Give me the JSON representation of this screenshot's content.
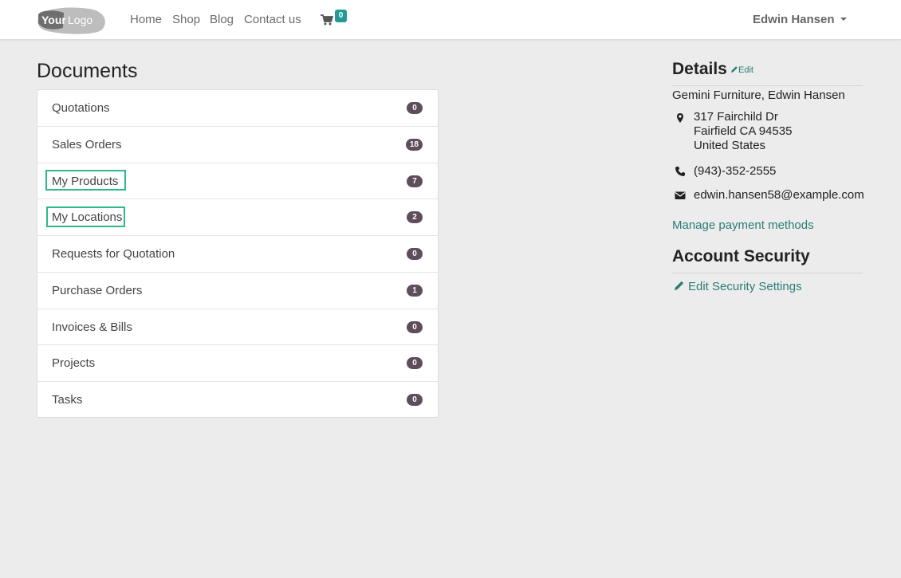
{
  "navbar": {
    "logo_text": "YourLogo",
    "links": [
      {
        "label": "Home"
      },
      {
        "label": "Shop"
      },
      {
        "label": "Blog"
      },
      {
        "label": "Contact us"
      }
    ],
    "cart_count": "0",
    "user_name": "Edwin Hansen"
  },
  "documents": {
    "title": "Documents",
    "rows": [
      {
        "label": "Quotations",
        "count": "0"
      },
      {
        "label": "Sales Orders",
        "count": "18"
      },
      {
        "label": "My Products",
        "count": "7"
      },
      {
        "label": "My Locations",
        "count": "2"
      },
      {
        "label": "Requests for Quotation",
        "count": "0"
      },
      {
        "label": "Purchase Orders",
        "count": "1"
      },
      {
        "label": "Invoices & Bills",
        "count": "0"
      },
      {
        "label": "Projects",
        "count": "0"
      },
      {
        "label": "Tasks",
        "count": "0"
      }
    ]
  },
  "details": {
    "title": "Details",
    "edit_label": "Edit",
    "partner": "Gemini Furniture, Edwin Hansen",
    "address_line1": "317 Fairchild Dr",
    "address_line2": "Fairfield CA 94535",
    "address_line3": "United States",
    "phone": "(943)-352-2555",
    "email": "edwin.hansen58@example.com",
    "payment_link": "Manage payment methods"
  },
  "security": {
    "title": "Account Security",
    "link": "Edit Security Settings"
  },
  "colors": {
    "accent": "#2a7d78",
    "badge": "#5e4d5b",
    "cart_badge": "#229a95",
    "highlight": "#2fb88f"
  }
}
